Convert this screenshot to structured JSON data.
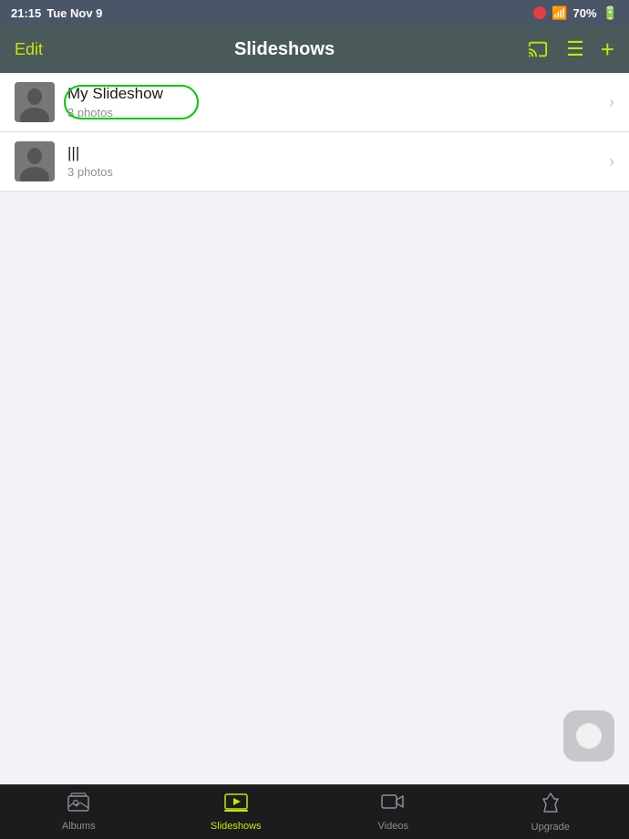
{
  "status_bar": {
    "time": "21:15",
    "day": "Tue Nov 9",
    "battery_pct": "70%",
    "wifi_active": true,
    "recording": true
  },
  "nav": {
    "edit_label": "Edit",
    "title": "Slideshows",
    "plus_label": "+"
  },
  "slideshows": [
    {
      "id": 1,
      "title": "My Slideshow",
      "subtitle": "3 photos",
      "highlighted": true
    },
    {
      "id": 2,
      "title": "|||",
      "subtitle": "3 photos",
      "highlighted": false
    }
  ],
  "tabs": [
    {
      "id": "albums",
      "label": "Albums",
      "active": false,
      "icon": "🖼"
    },
    {
      "id": "slideshows",
      "label": "Slideshows",
      "active": true,
      "icon": "📽"
    },
    {
      "id": "videos",
      "label": "Videos",
      "active": false,
      "icon": "🎥"
    },
    {
      "id": "upgrade",
      "label": "Upgrade",
      "active": false,
      "icon": "🚀"
    }
  ]
}
